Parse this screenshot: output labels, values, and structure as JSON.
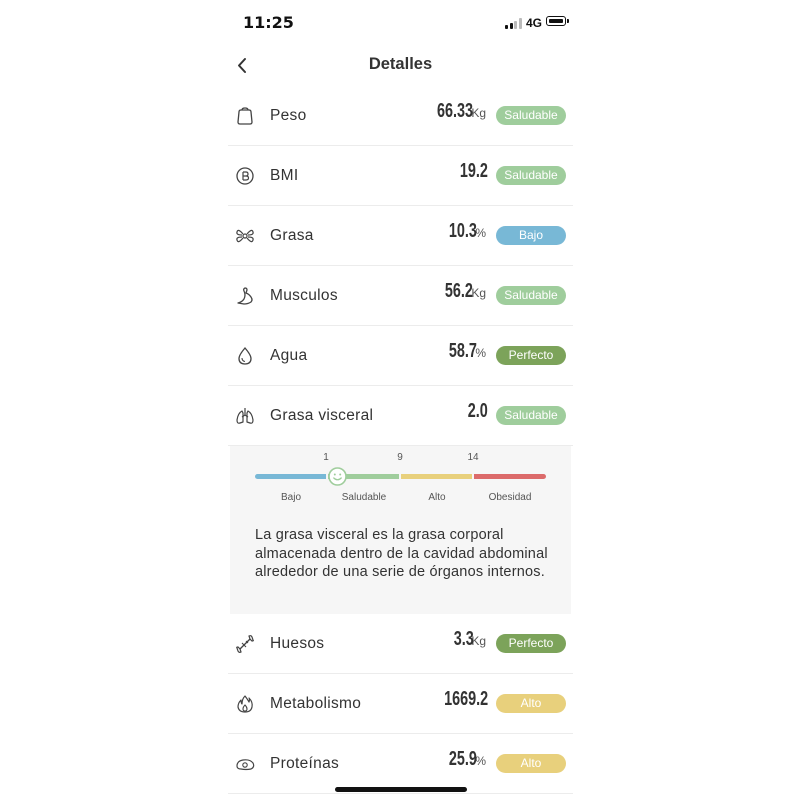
{
  "status_bar": {
    "time": "11:25",
    "network": "4G",
    "icons": [
      "signal-icon",
      "battery-icon"
    ]
  },
  "nav": {
    "title": "Detalles",
    "back_icon": "chevron-left-icon"
  },
  "metrics": [
    {
      "label": "Peso",
      "value": "66.33",
      "unit": "Kg",
      "status": "Saludable",
      "status_color": "#9fcd9c",
      "icon": "scale-icon"
    },
    {
      "label": "BMI",
      "value": "19.2",
      "unit": "",
      "status": "Saludable",
      "status_color": "#9fcd9c",
      "icon": "bmi-icon"
    },
    {
      "label": "Grasa",
      "value": "10.3",
      "unit": "%",
      "status": "Bajo",
      "status_color": "#78b8d6",
      "icon": "fat-icon"
    },
    {
      "label": "Musculos",
      "value": "56.2",
      "unit": "Kg",
      "status": "Saludable",
      "status_color": "#9fcd9c",
      "icon": "muscle-icon"
    },
    {
      "label": "Agua",
      "value": "58.7",
      "unit": "%",
      "status": "Perfecto",
      "status_color": "#7ca35a",
      "icon": "water-drop-icon"
    },
    {
      "label": "Grasa visceral",
      "value": "2.0",
      "unit": "",
      "status": "Saludable",
      "status_color": "#9fcd9c",
      "icon": "lungs-icon"
    },
    {
      "label": "Huesos",
      "value": "3.3",
      "unit": "Kg",
      "status": "Perfecto",
      "status_color": "#7ca35a",
      "icon": "bone-icon"
    },
    {
      "label": "Metabolismo",
      "value": "1669.2",
      "unit": "",
      "status": "Alto",
      "status_color": "#e8d07c",
      "icon": "flame-icon"
    },
    {
      "label": "Proteínas",
      "value": "25.9",
      "unit": "%",
      "status": "Alto",
      "status_color": "#e8d07c",
      "icon": "protein-icon"
    }
  ],
  "visceral_detail": {
    "thresholds": [
      "1",
      "9",
      "14"
    ],
    "categories": [
      {
        "label": "Bajo",
        "color": "#78b8d6"
      },
      {
        "label": "Saludable",
        "color": "#9fcd9c"
      },
      {
        "label": "Alto",
        "color": "#e8d07c"
      },
      {
        "label": "Obesidad",
        "color": "#dc6b6b"
      }
    ],
    "current_value": 2.0,
    "indicator_icon": "smiley-face-icon",
    "description": "La grasa visceral es la grasa corporal almacenada dentro de la cavidad abdominal alrededor de una serie de órganos internos."
  }
}
